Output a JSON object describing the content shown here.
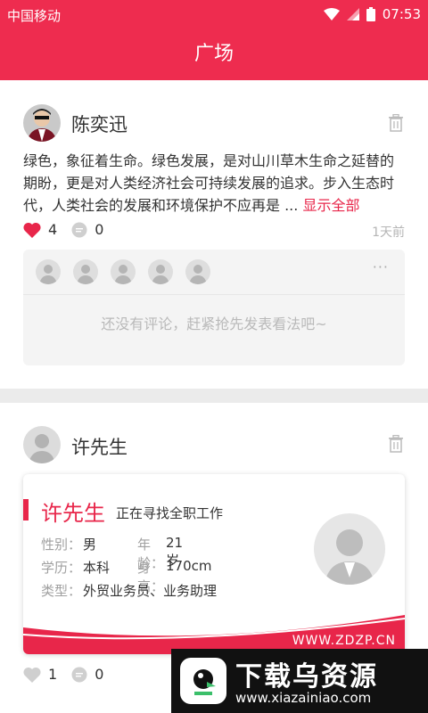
{
  "status_bar": {
    "carrier": "中国移动",
    "time": "07:53"
  },
  "header": {
    "title": "广场"
  },
  "posts": [
    {
      "username": "陈奕迅",
      "content": "绿色，象征着生命。绿色发展，是对山川草木生命之延替的期盼，更是对人类经济社会可持续发展的追求。步入生态时代，人类社会的发展和环境保护不应再是 ...",
      "show_all": "显示全部",
      "likes": "4",
      "comments": "0",
      "time": "1天前",
      "empty_comment": "还没有评论，赶紧抢先发表看法吧~",
      "more": "···"
    },
    {
      "username": "许先生",
      "likes": "1",
      "comments": "0",
      "resume": {
        "name": "许先生",
        "status": "正在寻找全职工作",
        "gender_label": "性别：",
        "gender": "男",
        "age_label": "年龄：",
        "age": "21岁",
        "education_label": "学历：",
        "education": "本科",
        "height_label": "身高：",
        "height": "170cm",
        "type_label": "类型：",
        "type": "外贸业务员、业务助理",
        "site": "WWW.ZDZP.CN"
      }
    }
  ],
  "watermark": {
    "title": "下载乌资源",
    "url": "www.xiazainiao.com"
  },
  "colors": {
    "primary": "#ee2c4f",
    "accent": "#e8264a"
  }
}
